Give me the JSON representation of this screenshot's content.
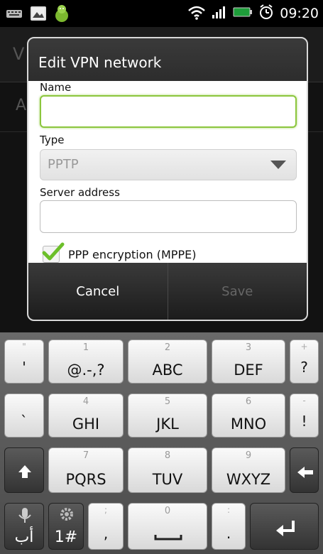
{
  "statusbar": {
    "time": "09:20"
  },
  "background": {
    "title_initial": "V",
    "row_initial": "A"
  },
  "dialog": {
    "title": "Edit VPN network",
    "name_label": "Name",
    "name_value": "",
    "type_label": "Type",
    "type_value": "PPTP",
    "server_label": "Server address",
    "server_value": "",
    "encryption_label": "PPP encryption (MPPE)",
    "encryption_checked": true,
    "cancel_label": "Cancel",
    "save_label": "Save"
  },
  "keyboard": {
    "row1": [
      {
        "top": "\"",
        "main": "'"
      },
      {
        "num": "1",
        "main": "@.-,?"
      },
      {
        "num": "2",
        "main": "ABC"
      },
      {
        "num": "3",
        "main": "DEF"
      },
      {
        "top": "+",
        "main": "?"
      }
    ],
    "row2": [
      {
        "top": "",
        "main": "`"
      },
      {
        "num": "4",
        "main": "GHI"
      },
      {
        "num": "5",
        "main": "JKL"
      },
      {
        "num": "6",
        "main": "MNO"
      },
      {
        "top": "-",
        "main": "!"
      }
    ],
    "row3": [
      {
        "num": "7",
        "main": "PQRS"
      },
      {
        "num": "8",
        "main": "TUV"
      },
      {
        "num": "9",
        "main": "WXYZ"
      }
    ],
    "row4": [
      {
        "main": "أب"
      },
      {
        "main": "1#"
      },
      {
        "top": ";",
        "main": ","
      },
      {
        "num": "0"
      },
      {
        "top": ":",
        "main": "."
      }
    ]
  },
  "colors": {
    "accent": "#8cc63e",
    "dialog_bar": "#2d2d2d",
    "keyboard_bg": "#5a5a5a"
  }
}
